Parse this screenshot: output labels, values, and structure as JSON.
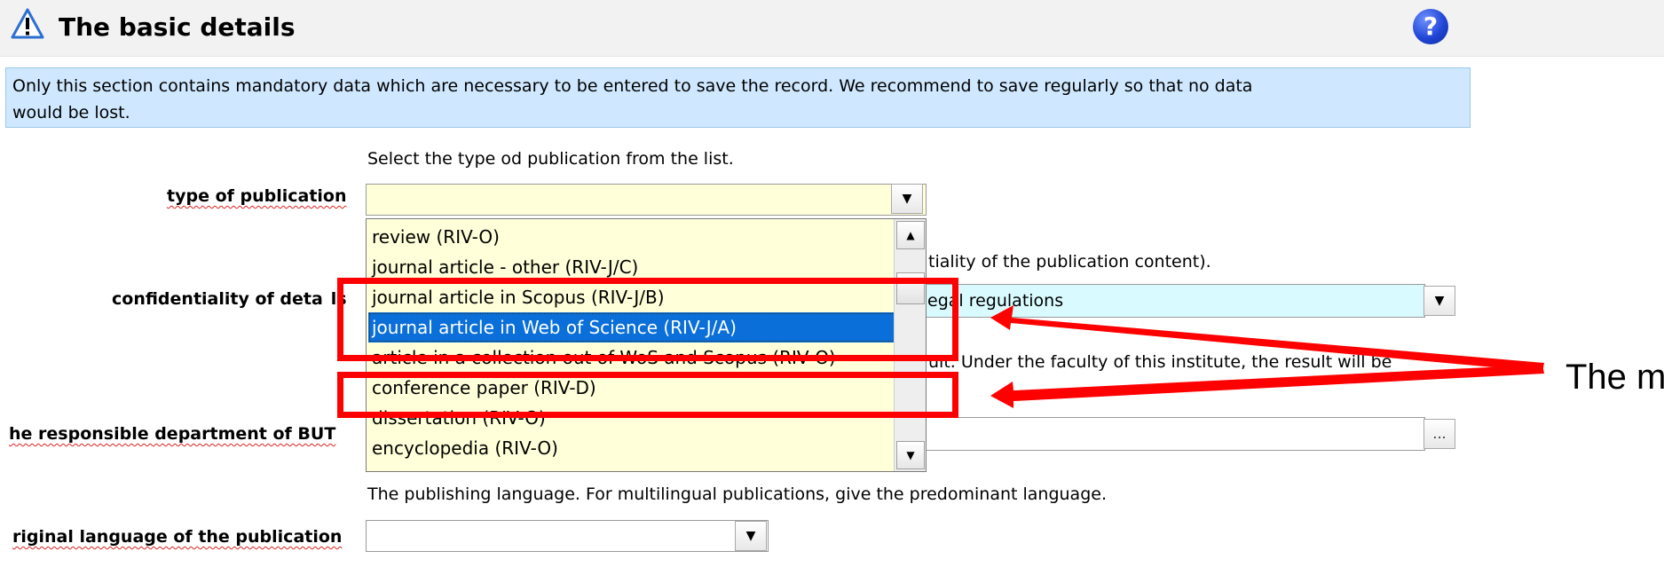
{
  "header": {
    "title": "The basic details",
    "warning_icon": "warning-triangle-icon",
    "help_icon": "help-question-icon",
    "help_glyph": "?"
  },
  "info": {
    "line1": "Only this section contains mandatory data which are necessary to be entered to save the record. We recommend to save regularly so that no data",
    "line2": "would be lost."
  },
  "form": {
    "type_hint": "Select the type od publication from the list.",
    "type_label": "type of publication",
    "type_value": "",
    "confidentiality_hint_tail": "tiality of the publication content).",
    "confidentiality_label_part1": "confidentiality of deta",
    "confidentiality_label_part2": "ls",
    "confidentiality_value_tail": "egal regulations",
    "department_hint_tail": "ult. Under the faculty of this institute, the result will be",
    "department_label": "he responsible department of BUT",
    "department_button": "...",
    "language_hint": "The publishing language. For multilingual publications, give the predominant language.",
    "language_label": "riginal language of the publication",
    "language_value": ""
  },
  "dropdown": {
    "options": [
      "review (RIV-O)",
      "journal article - other (RIV-J/C)",
      "journal article in Scopus (RIV-J/B)",
      "journal article in Web of Science (RIV-J/A)",
      "article in a collection out of WoS and Scopus (RIV-O)",
      "conference paper (RIV-D)",
      "dissertation (RIV-O)",
      "encyclopedia (RIV-O)"
    ],
    "selected_index": 3
  },
  "annotation": {
    "text": "The m",
    "color": "#ff0000"
  },
  "colors": {
    "info_bg": "#cfe8ff",
    "field_yellow": "#ffffd9",
    "field_cyan": "#d9fbff",
    "selection": "#0a6fd8"
  }
}
